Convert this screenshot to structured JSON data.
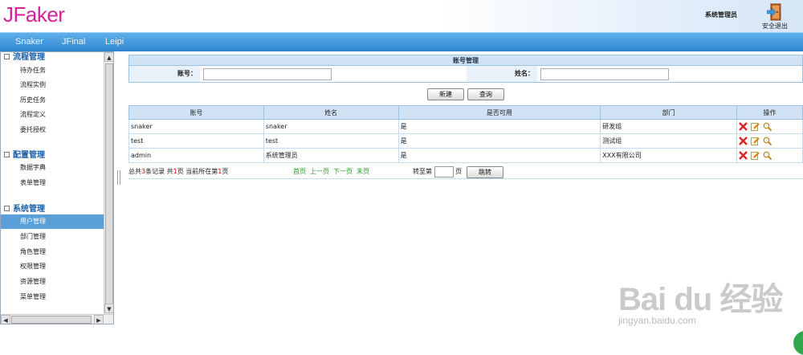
{
  "header": {
    "logo": "JFaker",
    "user_name": "系统管理员",
    "logout_label": "安全退出"
  },
  "nav": {
    "items": [
      "Snaker",
      "JFinal",
      "Leipi"
    ]
  },
  "sidebar": {
    "groups": [
      {
        "title": "流程管理",
        "items": [
          "待办任务",
          "流程实例",
          "历史任务",
          "流程定义",
          "委托授权"
        ]
      },
      {
        "title": "配置管理",
        "items": [
          "数据字典",
          "表单管理"
        ]
      },
      {
        "title": "系统管理",
        "items": [
          "用户管理",
          "部门管理",
          "角色管理",
          "权限管理",
          "资源管理",
          "菜单管理"
        ]
      }
    ],
    "active_item": "用户管理"
  },
  "search_form": {
    "title": "账号管理",
    "account_label": "账号：",
    "account_value": "",
    "name_label": "姓名：",
    "name_value": "",
    "new_button": "新建",
    "query_button": "查询"
  },
  "table": {
    "columns": [
      "账号",
      "姓名",
      "是否可用",
      "部门",
      "操作"
    ],
    "rows": [
      {
        "account": "snaker",
        "name": "snaker",
        "enabled": "是",
        "department": "研发组"
      },
      {
        "account": "test",
        "name": "test",
        "enabled": "是",
        "department": "测试组"
      },
      {
        "account": "admin",
        "name": "系统管理员",
        "enabled": "是",
        "department": "XXX有限公司"
      }
    ]
  },
  "pager": {
    "total_prefix": "总共",
    "total_count": "3",
    "total_suffix": "条记录",
    "pages_prefix": "共",
    "pages_count": "1",
    "pages_suffix": "页",
    "current_prefix": "当前所在第",
    "current_page": "1",
    "current_suffix": "页",
    "first": "首页",
    "prev": "上一页",
    "next": "下一页",
    "last": "末页",
    "goto_prefix": "转至第",
    "goto_suffix": "页",
    "goto_button": "跳转"
  },
  "watermark": {
    "brand": "Bai du 经验",
    "url": "jingyan.baidu.com"
  },
  "colors": {
    "logo": "#d6229a",
    "navbar": "#2f86cf",
    "active_menu": "#5a9fd8",
    "table_header": "#cfe3f5"
  },
  "icons": {
    "delete": "delete-icon",
    "edit": "edit-icon",
    "view": "view-icon",
    "logout": "logout-icon"
  }
}
